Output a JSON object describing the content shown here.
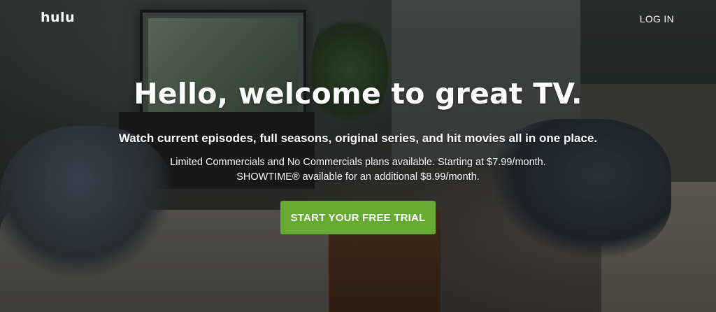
{
  "header": {
    "logo": "hulu",
    "login_label": "LOG IN"
  },
  "hero": {
    "headline": "Hello, welcome to great TV.",
    "subheadline": "Watch current episodes, full seasons, original series, and hit movies all in one place.",
    "plans_line_1": "Limited Commercials and No Commercials plans available. Starting at $7.99/month.",
    "plans_line_2": "SHOWTIME® available for an additional $8.99/month.",
    "cta_label": "START YOUR FREE TRIAL"
  },
  "colors": {
    "cta_green": "#66aa33",
    "text": "#ffffff"
  }
}
